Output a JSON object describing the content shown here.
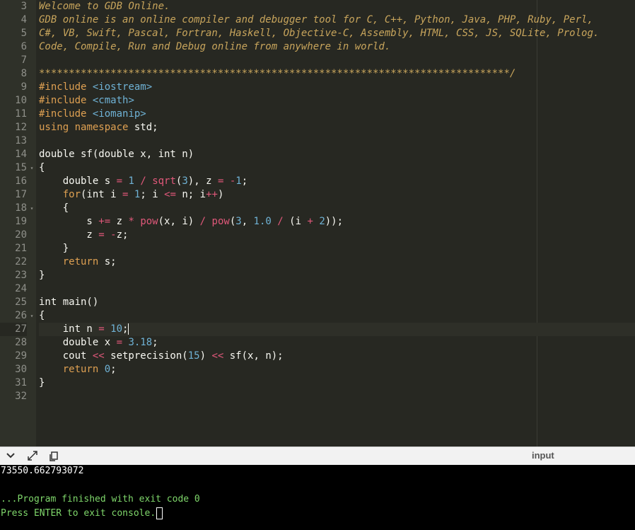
{
  "editor": {
    "lines": [
      {
        "n": "3",
        "fold": "",
        "tokens": [
          {
            "c": "c-comment",
            "t": "Welcome to GDB Online."
          }
        ]
      },
      {
        "n": "4",
        "fold": "",
        "tokens": [
          {
            "c": "c-comment",
            "t": "GDB online is an online compiler and debugger tool for C, C++, Python, Java, PHP, Ruby, Perl,"
          }
        ]
      },
      {
        "n": "5",
        "fold": "",
        "tokens": [
          {
            "c": "c-comment",
            "t": "C#, VB, Swift, Pascal, Fortran, Haskell, Objective-C, Assembly, HTML, CSS, JS, SQLite, Prolog."
          }
        ]
      },
      {
        "n": "6",
        "fold": "",
        "tokens": [
          {
            "c": "c-comment",
            "t": "Code, Compile, Run and Debug online from anywhere in world."
          }
        ]
      },
      {
        "n": "7",
        "fold": "",
        "tokens": []
      },
      {
        "n": "8",
        "fold": "",
        "tokens": [
          {
            "c": "c-comment",
            "t": "*******************************************************************************/"
          }
        ]
      },
      {
        "n": "9",
        "fold": "",
        "tokens": [
          {
            "c": "c-kw",
            "t": "#include"
          },
          {
            "c": "c-plain",
            "t": " "
          },
          {
            "c": "c-hdr",
            "t": "<iostream>"
          }
        ]
      },
      {
        "n": "10",
        "fold": "",
        "tokens": [
          {
            "c": "c-kw",
            "t": "#include"
          },
          {
            "c": "c-plain",
            "t": " "
          },
          {
            "c": "c-hdr",
            "t": "<cmath>"
          }
        ]
      },
      {
        "n": "11",
        "fold": "",
        "tokens": [
          {
            "c": "c-kw",
            "t": "#include"
          },
          {
            "c": "c-plain",
            "t": " "
          },
          {
            "c": "c-hdr",
            "t": "<iomanip>"
          }
        ]
      },
      {
        "n": "12",
        "fold": "",
        "tokens": [
          {
            "c": "c-kw",
            "t": "using"
          },
          {
            "c": "c-plain",
            "t": " "
          },
          {
            "c": "c-kw",
            "t": "namespace"
          },
          {
            "c": "c-plain",
            "t": " std;"
          }
        ]
      },
      {
        "n": "13",
        "fold": "",
        "tokens": []
      },
      {
        "n": "14",
        "fold": "",
        "tokens": [
          {
            "c": "c-plain",
            "t": "double sf(double x, int n)"
          }
        ]
      },
      {
        "n": "15",
        "fold": "▾",
        "tokens": [
          {
            "c": "c-plain",
            "t": "{"
          }
        ]
      },
      {
        "n": "16",
        "fold": "",
        "tokens": [
          {
            "c": "c-plain",
            "t": "    double s "
          },
          {
            "c": "c-op",
            "t": "="
          },
          {
            "c": "c-plain",
            "t": " "
          },
          {
            "c": "c-num",
            "t": "1"
          },
          {
            "c": "c-plain",
            "t": " "
          },
          {
            "c": "c-op",
            "t": "/"
          },
          {
            "c": "c-plain",
            "t": " "
          },
          {
            "c": "c-fn",
            "t": "sqrt"
          },
          {
            "c": "c-plain",
            "t": "("
          },
          {
            "c": "c-num",
            "t": "3"
          },
          {
            "c": "c-plain",
            "t": "), z "
          },
          {
            "c": "c-op",
            "t": "="
          },
          {
            "c": "c-plain",
            "t": " "
          },
          {
            "c": "c-op",
            "t": "-"
          },
          {
            "c": "c-num",
            "t": "1"
          },
          {
            "c": "c-plain",
            "t": ";"
          }
        ]
      },
      {
        "n": "17",
        "fold": "",
        "tokens": [
          {
            "c": "c-plain",
            "t": "    "
          },
          {
            "c": "c-kw",
            "t": "for"
          },
          {
            "c": "c-plain",
            "t": "(int i "
          },
          {
            "c": "c-op",
            "t": "="
          },
          {
            "c": "c-plain",
            "t": " "
          },
          {
            "c": "c-num",
            "t": "1"
          },
          {
            "c": "c-plain",
            "t": "; i "
          },
          {
            "c": "c-op",
            "t": "<="
          },
          {
            "c": "c-plain",
            "t": " n; i"
          },
          {
            "c": "c-op",
            "t": "++"
          },
          {
            "c": "c-plain",
            "t": ")"
          }
        ]
      },
      {
        "n": "18",
        "fold": "▾",
        "tokens": [
          {
            "c": "c-plain",
            "t": "    {"
          }
        ]
      },
      {
        "n": "19",
        "fold": "",
        "tokens": [
          {
            "c": "c-plain",
            "t": "        s "
          },
          {
            "c": "c-op",
            "t": "+="
          },
          {
            "c": "c-plain",
            "t": " z "
          },
          {
            "c": "c-op",
            "t": "*"
          },
          {
            "c": "c-plain",
            "t": " "
          },
          {
            "c": "c-fn",
            "t": "pow"
          },
          {
            "c": "c-plain",
            "t": "(x, i) "
          },
          {
            "c": "c-op",
            "t": "/"
          },
          {
            "c": "c-plain",
            "t": " "
          },
          {
            "c": "c-fn",
            "t": "pow"
          },
          {
            "c": "c-plain",
            "t": "("
          },
          {
            "c": "c-num",
            "t": "3"
          },
          {
            "c": "c-plain",
            "t": ", "
          },
          {
            "c": "c-num",
            "t": "1.0"
          },
          {
            "c": "c-plain",
            "t": " "
          },
          {
            "c": "c-op",
            "t": "/"
          },
          {
            "c": "c-plain",
            "t": " (i "
          },
          {
            "c": "c-op",
            "t": "+"
          },
          {
            "c": "c-plain",
            "t": " "
          },
          {
            "c": "c-num",
            "t": "2"
          },
          {
            "c": "c-plain",
            "t": "));"
          }
        ]
      },
      {
        "n": "20",
        "fold": "",
        "tokens": [
          {
            "c": "c-plain",
            "t": "        z "
          },
          {
            "c": "c-op",
            "t": "="
          },
          {
            "c": "c-plain",
            "t": " "
          },
          {
            "c": "c-op",
            "t": "-"
          },
          {
            "c": "c-plain",
            "t": "z;"
          }
        ]
      },
      {
        "n": "21",
        "fold": "",
        "tokens": [
          {
            "c": "c-plain",
            "t": "    }"
          }
        ]
      },
      {
        "n": "22",
        "fold": "",
        "tokens": [
          {
            "c": "c-plain",
            "t": "    "
          },
          {
            "c": "c-kw",
            "t": "return"
          },
          {
            "c": "c-plain",
            "t": " s;"
          }
        ]
      },
      {
        "n": "23",
        "fold": "",
        "tokens": [
          {
            "c": "c-plain",
            "t": "}"
          }
        ]
      },
      {
        "n": "24",
        "fold": "",
        "tokens": []
      },
      {
        "n": "25",
        "fold": "",
        "tokens": [
          {
            "c": "c-plain",
            "t": "int main()"
          }
        ]
      },
      {
        "n": "26",
        "fold": "▾",
        "tokens": [
          {
            "c": "c-plain",
            "t": "{"
          }
        ]
      },
      {
        "n": "27",
        "fold": "",
        "active": true,
        "tokens": [
          {
            "c": "c-plain",
            "t": "    int n "
          },
          {
            "c": "c-op",
            "t": "="
          },
          {
            "c": "c-plain",
            "t": " "
          },
          {
            "c": "c-num",
            "t": "10"
          },
          {
            "c": "c-plain",
            "t": ";"
          }
        ]
      },
      {
        "n": "28",
        "fold": "",
        "tokens": [
          {
            "c": "c-plain",
            "t": "    double x "
          },
          {
            "c": "c-op",
            "t": "="
          },
          {
            "c": "c-plain",
            "t": " "
          },
          {
            "c": "c-num",
            "t": "3.18"
          },
          {
            "c": "c-plain",
            "t": ";"
          }
        ]
      },
      {
        "n": "29",
        "fold": "",
        "tokens": [
          {
            "c": "c-plain",
            "t": "    cout "
          },
          {
            "c": "c-op",
            "t": "<<"
          },
          {
            "c": "c-plain",
            "t": " setprecision("
          },
          {
            "c": "c-num",
            "t": "15"
          },
          {
            "c": "c-plain",
            "t": ") "
          },
          {
            "c": "c-op",
            "t": "<<"
          },
          {
            "c": "c-plain",
            "t": " sf(x, n);"
          }
        ]
      },
      {
        "n": "30",
        "fold": "",
        "tokens": [
          {
            "c": "c-plain",
            "t": "    "
          },
          {
            "c": "c-kw",
            "t": "return"
          },
          {
            "c": "c-plain",
            "t": " "
          },
          {
            "c": "c-num",
            "t": "0"
          },
          {
            "c": "c-plain",
            "t": ";"
          }
        ]
      },
      {
        "n": "31",
        "fold": "",
        "tokens": [
          {
            "c": "c-plain",
            "t": "}"
          }
        ]
      },
      {
        "n": "32",
        "fold": "",
        "tokens": []
      }
    ]
  },
  "toolbar": {
    "collapse_icon": "chevron-down-icon",
    "expand_icon": "expand-icon",
    "copy_icon": "copy-icon",
    "input_label": "input"
  },
  "console": {
    "output": "73550.662793072",
    "finished": "...Program finished with exit code 0",
    "prompt": "Press ENTER to exit console."
  },
  "colors": {
    "editor_bg": "#272822",
    "gutter_bg": "#2f3129",
    "comment": "#c8a55c",
    "keyword": "#dea052",
    "number": "#6fb2d5",
    "operator": "#e0587a",
    "console_bg": "#000000",
    "console_green": "#7fd76b"
  }
}
